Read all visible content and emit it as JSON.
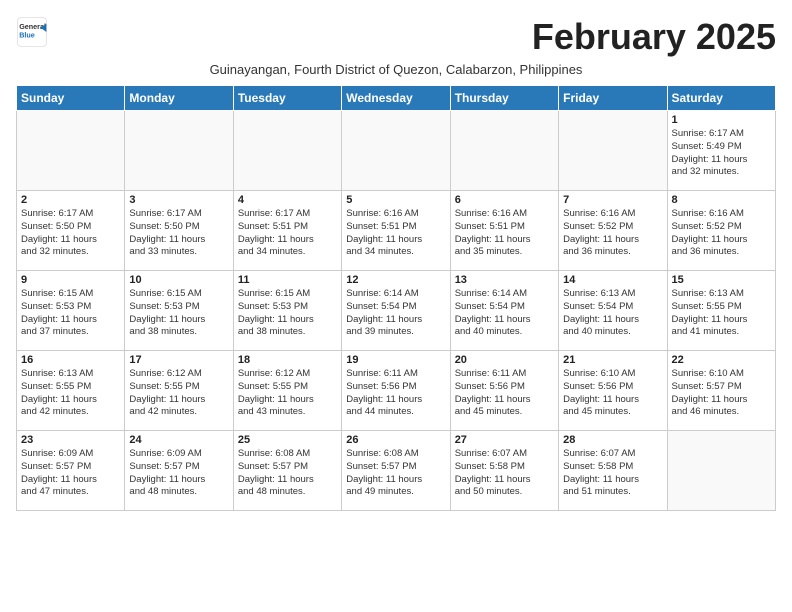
{
  "header": {
    "logo_general": "General",
    "logo_blue": "Blue",
    "month_title": "February 2025",
    "location": "Guinayangan, Fourth District of Quezon, Calabarzon, Philippines"
  },
  "weekdays": [
    "Sunday",
    "Monday",
    "Tuesday",
    "Wednesday",
    "Thursday",
    "Friday",
    "Saturday"
  ],
  "weeks": [
    [
      {
        "day": "",
        "info": ""
      },
      {
        "day": "",
        "info": ""
      },
      {
        "day": "",
        "info": ""
      },
      {
        "day": "",
        "info": ""
      },
      {
        "day": "",
        "info": ""
      },
      {
        "day": "",
        "info": ""
      },
      {
        "day": "1",
        "info": "Sunrise: 6:17 AM\nSunset: 5:49 PM\nDaylight: 11 hours\nand 32 minutes."
      }
    ],
    [
      {
        "day": "2",
        "info": "Sunrise: 6:17 AM\nSunset: 5:50 PM\nDaylight: 11 hours\nand 32 minutes."
      },
      {
        "day": "3",
        "info": "Sunrise: 6:17 AM\nSunset: 5:50 PM\nDaylight: 11 hours\nand 33 minutes."
      },
      {
        "day": "4",
        "info": "Sunrise: 6:17 AM\nSunset: 5:51 PM\nDaylight: 11 hours\nand 34 minutes."
      },
      {
        "day": "5",
        "info": "Sunrise: 6:16 AM\nSunset: 5:51 PM\nDaylight: 11 hours\nand 34 minutes."
      },
      {
        "day": "6",
        "info": "Sunrise: 6:16 AM\nSunset: 5:51 PM\nDaylight: 11 hours\nand 35 minutes."
      },
      {
        "day": "7",
        "info": "Sunrise: 6:16 AM\nSunset: 5:52 PM\nDaylight: 11 hours\nand 36 minutes."
      },
      {
        "day": "8",
        "info": "Sunrise: 6:16 AM\nSunset: 5:52 PM\nDaylight: 11 hours\nand 36 minutes."
      }
    ],
    [
      {
        "day": "9",
        "info": "Sunrise: 6:15 AM\nSunset: 5:53 PM\nDaylight: 11 hours\nand 37 minutes."
      },
      {
        "day": "10",
        "info": "Sunrise: 6:15 AM\nSunset: 5:53 PM\nDaylight: 11 hours\nand 38 minutes."
      },
      {
        "day": "11",
        "info": "Sunrise: 6:15 AM\nSunset: 5:53 PM\nDaylight: 11 hours\nand 38 minutes."
      },
      {
        "day": "12",
        "info": "Sunrise: 6:14 AM\nSunset: 5:54 PM\nDaylight: 11 hours\nand 39 minutes."
      },
      {
        "day": "13",
        "info": "Sunrise: 6:14 AM\nSunset: 5:54 PM\nDaylight: 11 hours\nand 40 minutes."
      },
      {
        "day": "14",
        "info": "Sunrise: 6:13 AM\nSunset: 5:54 PM\nDaylight: 11 hours\nand 40 minutes."
      },
      {
        "day": "15",
        "info": "Sunrise: 6:13 AM\nSunset: 5:55 PM\nDaylight: 11 hours\nand 41 minutes."
      }
    ],
    [
      {
        "day": "16",
        "info": "Sunrise: 6:13 AM\nSunset: 5:55 PM\nDaylight: 11 hours\nand 42 minutes."
      },
      {
        "day": "17",
        "info": "Sunrise: 6:12 AM\nSunset: 5:55 PM\nDaylight: 11 hours\nand 42 minutes."
      },
      {
        "day": "18",
        "info": "Sunrise: 6:12 AM\nSunset: 5:55 PM\nDaylight: 11 hours\nand 43 minutes."
      },
      {
        "day": "19",
        "info": "Sunrise: 6:11 AM\nSunset: 5:56 PM\nDaylight: 11 hours\nand 44 minutes."
      },
      {
        "day": "20",
        "info": "Sunrise: 6:11 AM\nSunset: 5:56 PM\nDaylight: 11 hours\nand 45 minutes."
      },
      {
        "day": "21",
        "info": "Sunrise: 6:10 AM\nSunset: 5:56 PM\nDaylight: 11 hours\nand 45 minutes."
      },
      {
        "day": "22",
        "info": "Sunrise: 6:10 AM\nSunset: 5:57 PM\nDaylight: 11 hours\nand 46 minutes."
      }
    ],
    [
      {
        "day": "23",
        "info": "Sunrise: 6:09 AM\nSunset: 5:57 PM\nDaylight: 11 hours\nand 47 minutes."
      },
      {
        "day": "24",
        "info": "Sunrise: 6:09 AM\nSunset: 5:57 PM\nDaylight: 11 hours\nand 48 minutes."
      },
      {
        "day": "25",
        "info": "Sunrise: 6:08 AM\nSunset: 5:57 PM\nDaylight: 11 hours\nand 48 minutes."
      },
      {
        "day": "26",
        "info": "Sunrise: 6:08 AM\nSunset: 5:57 PM\nDaylight: 11 hours\nand 49 minutes."
      },
      {
        "day": "27",
        "info": "Sunrise: 6:07 AM\nSunset: 5:58 PM\nDaylight: 11 hours\nand 50 minutes."
      },
      {
        "day": "28",
        "info": "Sunrise: 6:07 AM\nSunset: 5:58 PM\nDaylight: 11 hours\nand 51 minutes."
      },
      {
        "day": "",
        "info": ""
      }
    ]
  ]
}
